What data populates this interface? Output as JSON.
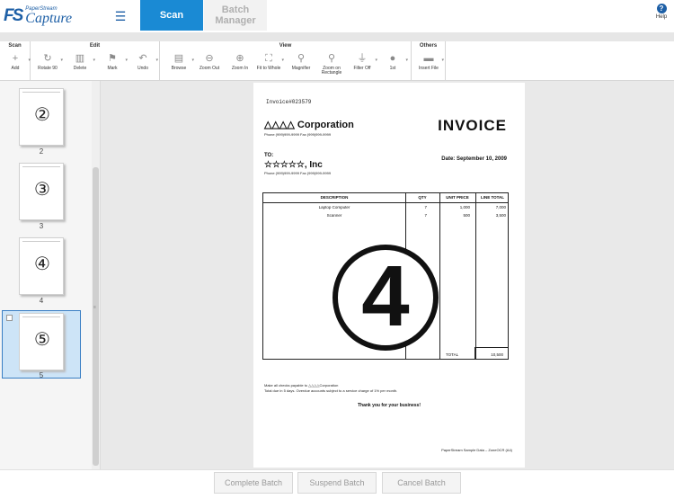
{
  "header": {
    "logo_mark": "FS",
    "logo_sub": "PaperStream",
    "logo_main": "Capture",
    "menu_icon": "hamburger-icon",
    "tabs": [
      {
        "label": "Scan",
        "active": true
      },
      {
        "label": "Batch Manager",
        "active": false
      }
    ],
    "help_label": "Help",
    "help_glyph": "?"
  },
  "ribbon": {
    "groups": [
      {
        "title": "Scan",
        "tools": [
          {
            "label": "Add",
            "icon": "add-scan-icon",
            "glyph": "+"
          }
        ]
      },
      {
        "title": "Edit",
        "tools": [
          {
            "label": "Rotate 90",
            "icon": "rotate-icon",
            "glyph": "↻"
          },
          {
            "label": "Delete",
            "icon": "trash-icon",
            "glyph": "▥"
          },
          {
            "label": "Mark",
            "icon": "flag-icon",
            "glyph": "⚑"
          },
          {
            "label": "Undo",
            "icon": "undo-icon",
            "glyph": "↶"
          }
        ]
      },
      {
        "title": "View",
        "tools": [
          {
            "label": "Browse",
            "icon": "browse-icon",
            "glyph": "▤"
          },
          {
            "label": "Zoom Out",
            "icon": "zoom-out-icon",
            "glyph": "⊖"
          },
          {
            "label": "Zoom In",
            "icon": "zoom-in-icon",
            "glyph": "⊕"
          },
          {
            "label": "Fit to Whole",
            "icon": "fit-whole-icon",
            "glyph": "⛶"
          },
          {
            "label": "Magnifier",
            "icon": "magnifier-icon",
            "glyph": "⚲"
          },
          {
            "label": "Zoom on Rectangle",
            "icon": "zoom-rect-icon",
            "glyph": "⚲"
          },
          {
            "label": "Filter Off",
            "icon": "filter-icon",
            "glyph": "⏚"
          },
          {
            "label": "1st",
            "icon": "first-page-icon",
            "glyph": "●"
          }
        ]
      },
      {
        "title": "Others",
        "tools": [
          {
            "label": "Insert File",
            "icon": "insert-file-icon",
            "glyph": "▬"
          }
        ]
      }
    ]
  },
  "thumbnails": [
    {
      "number": "②",
      "caption": "2"
    },
    {
      "number": "③",
      "caption": "3"
    },
    {
      "number": "④",
      "caption": "4"
    },
    {
      "number": "⑤",
      "caption": "5"
    }
  ],
  "scroll_grip": "≡",
  "document": {
    "invoice_number": "Invoice#023579",
    "company": "△△△△ Corporation",
    "company_phone": "Phone (999)999-9999   Fax (999)999-9999",
    "title": "INVOICE",
    "to_label": "TO:",
    "customer": "☆☆☆☆☆, Inc",
    "customer_phone": "Phone (999)999-9999   Fax (999)999-9999",
    "date": "Date: September 10, 2009",
    "columns": [
      "DESCRIPTION",
      "QTY",
      "UNIT PRICE",
      "LINE TOTAL"
    ],
    "rows": [
      {
        "description": "Laptop Computer",
        "qty": "7",
        "unit_price": "1,000",
        "line_total": "7,000"
      },
      {
        "description": "Scanner",
        "qty": "7",
        "unit_price": "500",
        "line_total": "3,500"
      }
    ],
    "total_label": "TOTAL",
    "total_value": "10,500",
    "page_stamp": "4",
    "note_1": "Make all checks payable to △△△△Corporation",
    "note_2": "Total due in 5 days. Overdue accounts subject to a service charge of 1% per month.",
    "thanks": "Thank you for your business!",
    "footer": "PaperStream Sample Data – ZoneOCR (A4)"
  },
  "bottom_buttons": [
    {
      "label": "Complete Batch"
    },
    {
      "label": "Suspend Batch"
    },
    {
      "label": "Cancel Batch"
    }
  ],
  "colors": {
    "accent": "#1a8ad4",
    "brand": "#1d5fa6",
    "selection": "#cde4f7"
  }
}
